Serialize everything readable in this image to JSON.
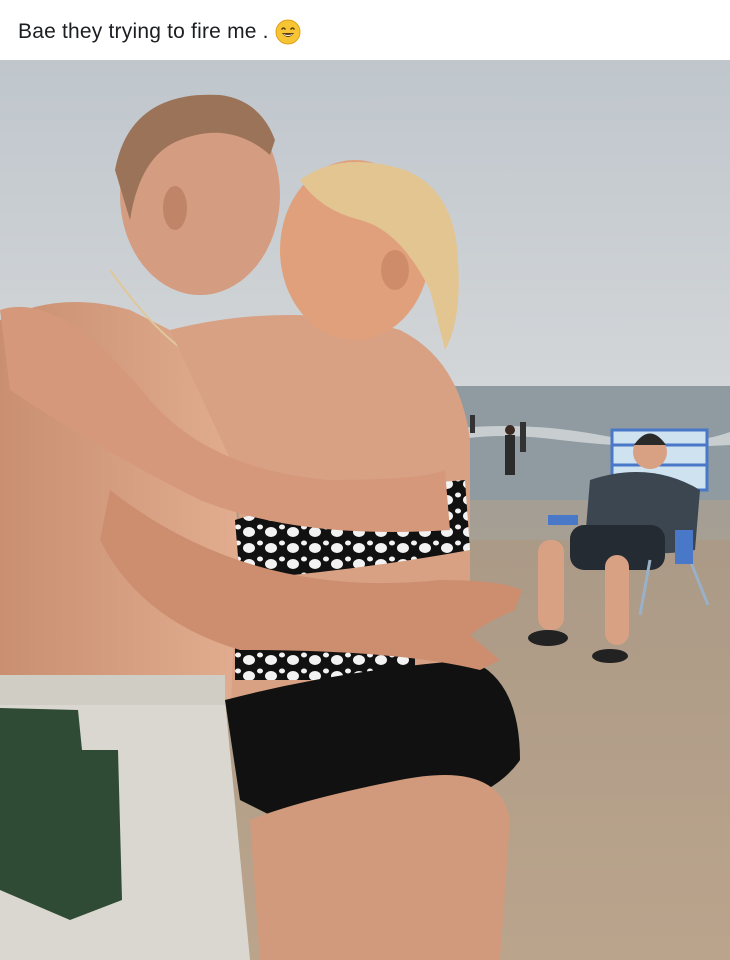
{
  "post": {
    "caption": "Bae they trying to fire me .",
    "caption_emoji": "smiling-face-emoji"
  },
  "photo": {
    "icon": "beach-photo-image"
  },
  "colors": {
    "sky": "#c9ced3",
    "sea": "#8e9aa0",
    "sand": "#b49d86",
    "skin": "#d8a184",
    "swimsuit": "#111111",
    "shorts_light": "#d9d7cf",
    "shorts_dark": "#2f4b36",
    "chair_blue": "#4a78c8"
  }
}
